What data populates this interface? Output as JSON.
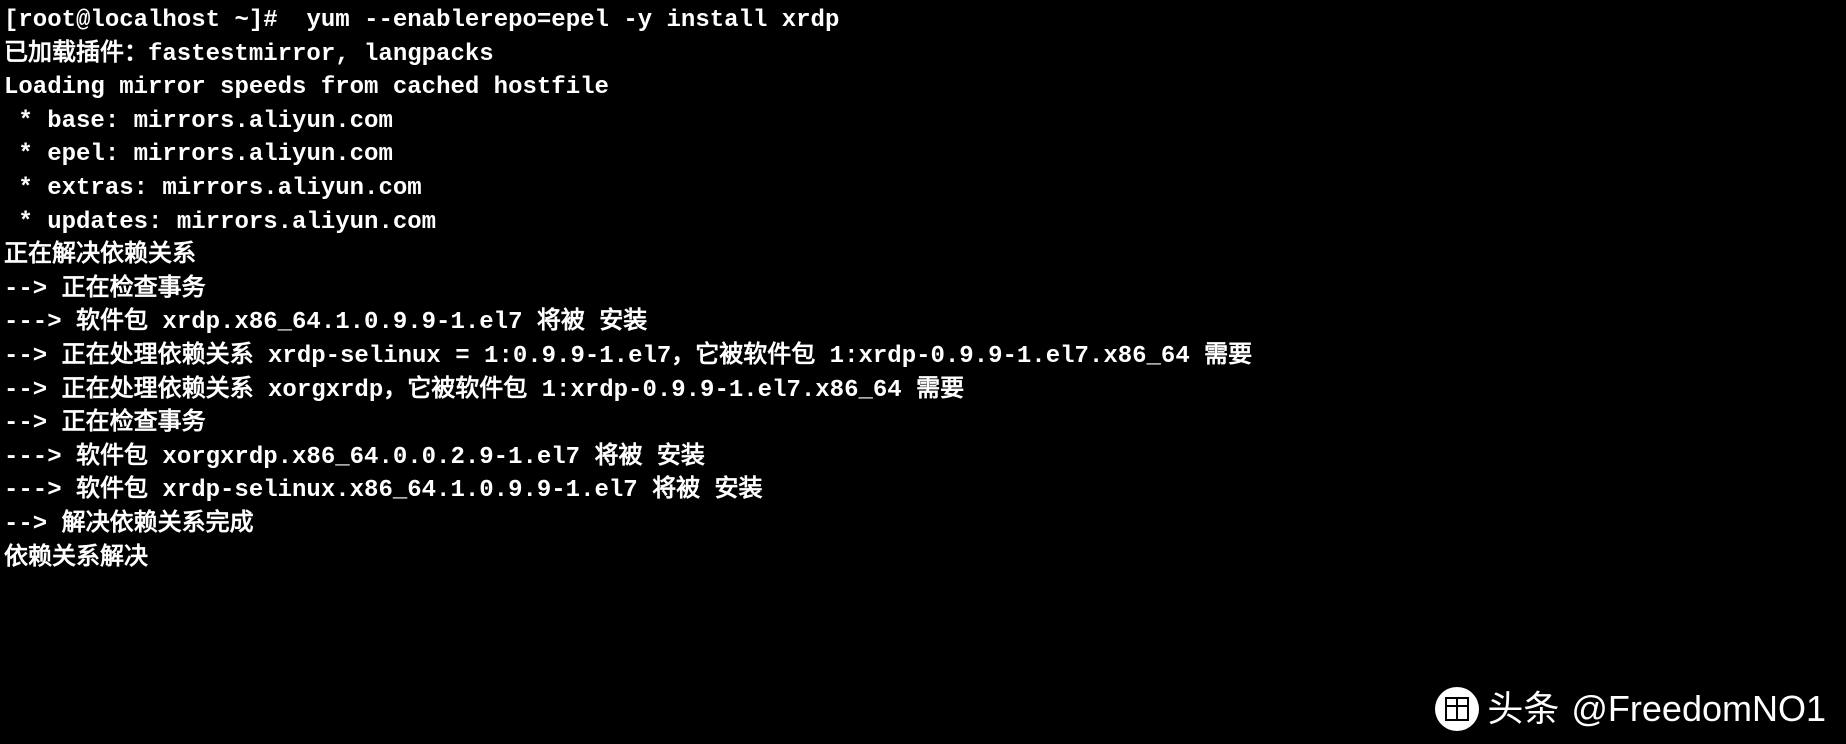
{
  "terminal": {
    "prompt": "[root@localhost ~]#",
    "command": " yum --enablerepo=epel -y install xrdp",
    "lines": [
      "已加载插件：fastestmirror, langpacks",
      "Loading mirror speeds from cached hostfile",
      " * base: mirrors.aliyun.com",
      " * epel: mirrors.aliyun.com",
      " * extras: mirrors.aliyun.com",
      " * updates: mirrors.aliyun.com",
      "正在解决依赖关系",
      "--> 正在检查事务",
      "---> 软件包 xrdp.x86_64.1.0.9.9-1.el7 将被 安装",
      "--> 正在处理依赖关系 xrdp-selinux = 1:0.9.9-1.el7，它被软件包 1:xrdp-0.9.9-1.el7.x86_64 需要",
      "--> 正在处理依赖关系 xorgxrdp，它被软件包 1:xrdp-0.9.9-1.el7.x86_64 需要",
      "--> 正在检查事务",
      "---> 软件包 xorgxrdp.x86_64.0.0.2.9-1.el7 将被 安装",
      "---> 软件包 xrdp-selinux.x86_64.1.0.9.9-1.el7 将被 安装",
      "--> 解决依赖关系完成",
      "",
      "依赖关系解决"
    ]
  },
  "watermark": {
    "brand": "头条",
    "handle": "@FreedomNO1"
  }
}
